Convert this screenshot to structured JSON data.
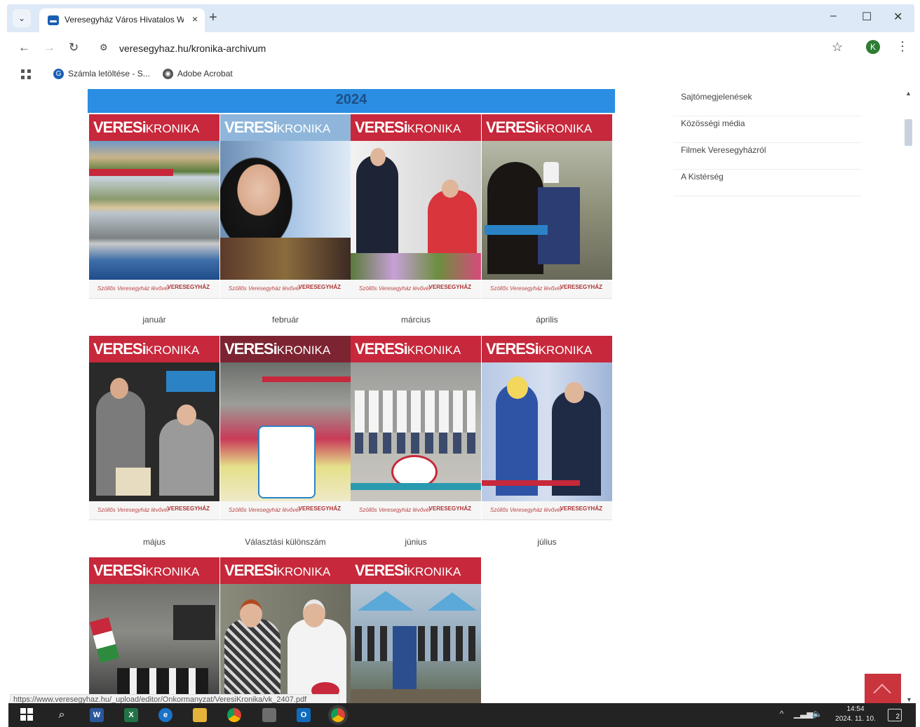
{
  "browser": {
    "tab_title": "Veresegyház Város Hivatalos W",
    "tab_close": "×",
    "new_tab": "+",
    "url": "veresegyhaz.hu/kronika-archivum",
    "profile_initial": "K",
    "window_controls": {
      "minimize": "–",
      "maximize": "☐",
      "close": "✕"
    },
    "bookmarks": [
      {
        "label": "Számla letöltése - S...",
        "icon": "google-icon"
      },
      {
        "label": "Adobe Acrobat",
        "icon": "globe-icon"
      }
    ]
  },
  "page": {
    "year": "2024",
    "cover_logo": "VERESi",
    "cover_logo_suffix": "KRONIKA",
    "covers": [
      {
        "month": "január"
      },
      {
        "month": "február"
      },
      {
        "month": "március"
      },
      {
        "month": "április"
      },
      {
        "month": "május"
      },
      {
        "month": "Választási különszám"
      },
      {
        "month": "június"
      },
      {
        "month": "július"
      },
      {
        "month": ""
      },
      {
        "month": ""
      },
      {
        "month": ""
      }
    ],
    "sidebar": [
      {
        "label": "Sajtómegjelenések"
      },
      {
        "label": "Közösségi média"
      },
      {
        "label": "Filmek Veresegyházról"
      },
      {
        "label": "A Kistérség"
      }
    ],
    "status_url": "https://www.veresegyhaz.hu/_upload/editor/Onkormanyzat/VeresiKronika/vk_2407.pdf"
  },
  "taskbar": {
    "time": "14:54",
    "date": "2024. 11. 10.",
    "notification_count": "2",
    "apps": [
      "windows-start-icon",
      "search-icon",
      "word-icon",
      "excel-icon",
      "edge-icon",
      "file-explorer-icon",
      "chrome-icon",
      "store-icon",
      "outlook-icon",
      "chrome-icon"
    ]
  },
  "colors": {
    "year_bar": "#2b8ee2",
    "cover_header": "#c7283b",
    "back_to_top": "#c9343d",
    "tab_strip": "#dde9f6"
  }
}
